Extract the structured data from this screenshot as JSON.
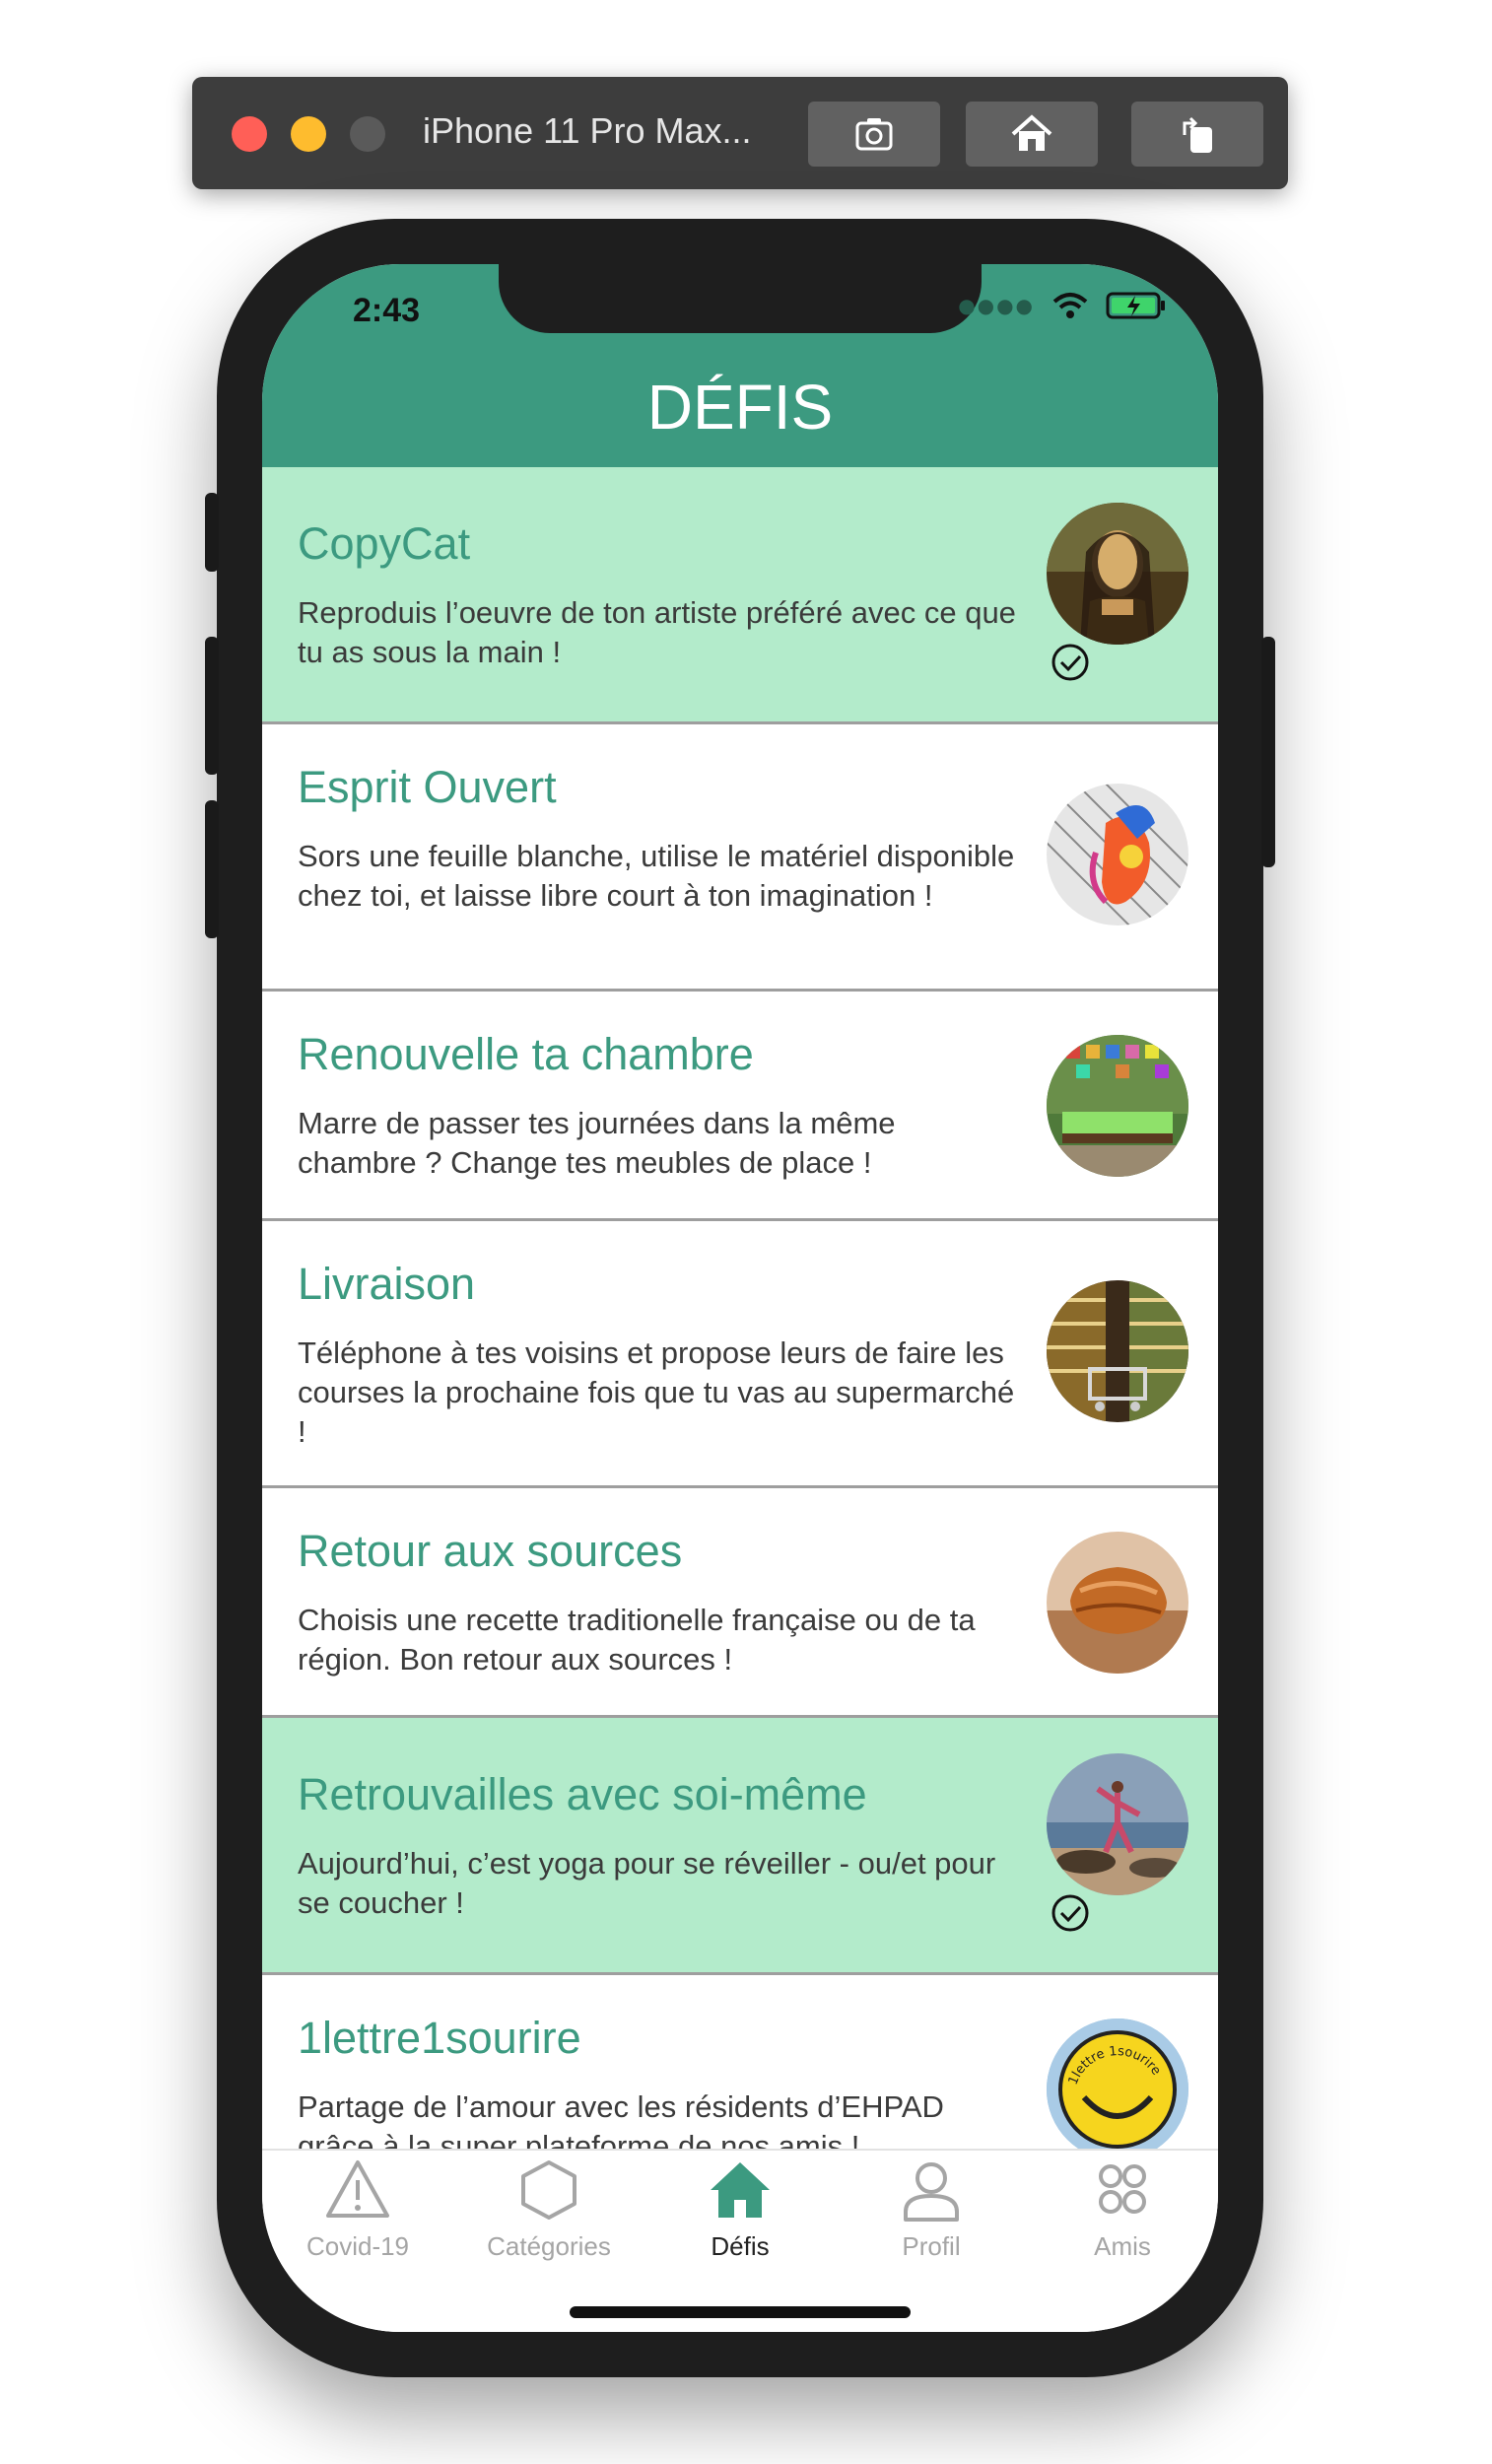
{
  "simulator": {
    "title": "iPhone 11 Pro Max...",
    "buttons": [
      "screenshot-icon",
      "home-icon",
      "rotate-icon"
    ]
  },
  "status_bar": {
    "time": "2:43",
    "icons": [
      "signal-icon",
      "wifi-icon",
      "battery-charging-icon"
    ]
  },
  "header": {
    "title": "DÉFIS"
  },
  "challenges": [
    {
      "title": "CopyCat",
      "description": "Reproduis l’oeuvre de ton artiste préféré avec ce que tu as sous la main !",
      "completed": true,
      "image": "mona-lisa-thumbnail"
    },
    {
      "title": "Esprit Ouvert",
      "description": "Sors une feuille blanche, utilise le matériel disponible chez toi, et laisse libre court à ton imagination !",
      "completed": false,
      "image": "colorful-drawing-thumbnail"
    },
    {
      "title": "Renouvelle ta chambre",
      "description": "Marre de passer tes journées dans la même chambre ? Change tes meubles de place !",
      "completed": false,
      "image": "bedroom-thumbnail"
    },
    {
      "title": "Livraison",
      "description": "Téléphone à tes voisins et propose leurs de faire les courses la prochaine fois que tu vas au supermarché !",
      "completed": false,
      "image": "supermarket-thumbnail"
    },
    {
      "title": "Retour aux sources",
      "description": "Choisis une recette traditionelle française ou de ta région. Bon retour aux sources !",
      "completed": false,
      "image": "pain-au-chocolat-thumbnail"
    },
    {
      "title": "Retrouvailles avec soi-même",
      "description": "Aujourd’hui, c’est yoga pour se réveiller - ou/et pour se coucher !",
      "completed": true,
      "image": "yoga-beach-thumbnail"
    },
    {
      "title": "1lettre1sourire",
      "description": "Partage de l’amour avec les résidents d’EHPAD grâce à la super plateforme de nos amis !",
      "completed": false,
      "image": "smiley-logo-thumbnail",
      "logo_text": "1lettre 1sourire"
    }
  ],
  "tabs": [
    {
      "label": "Covid-19",
      "icon": "warning-icon",
      "active": false
    },
    {
      "label": "Catégories",
      "icon": "hexagon-icon",
      "active": false
    },
    {
      "label": "Défis",
      "icon": "home-icon",
      "active": true
    },
    {
      "label": "Profil",
      "icon": "user-icon",
      "active": false
    },
    {
      "label": "Amis",
      "icon": "friends-icon",
      "active": false
    }
  ],
  "colors": {
    "accent": "#3c9a80",
    "completed_row": "#b3ebcb",
    "tab_inactive": "#a5a5a5"
  }
}
